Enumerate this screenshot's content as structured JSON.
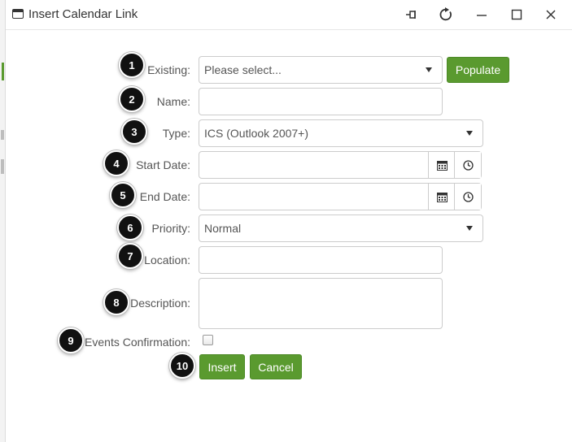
{
  "window": {
    "title": "Insert Calendar Link",
    "controls": [
      "pin-icon",
      "refresh-icon",
      "minimize-icon",
      "maximize-icon",
      "close-icon"
    ]
  },
  "form": {
    "existing": {
      "label": "Existing:",
      "value": "Please select...",
      "badge": "1"
    },
    "populate_label": "Populate",
    "name": {
      "label": "Name:",
      "value": "",
      "badge": "2"
    },
    "type": {
      "label": "Type:",
      "value": "ICS (Outlook 2007+)",
      "badge": "3"
    },
    "start_date": {
      "label": "Start Date:",
      "value": "",
      "badge": "4"
    },
    "end_date": {
      "label": "End Date:",
      "value": "",
      "badge": "5"
    },
    "priority": {
      "label": "Priority:",
      "value": "Normal",
      "badge": "6"
    },
    "location": {
      "label": "Location:",
      "value": "",
      "badge": "7"
    },
    "description": {
      "label": "Description:",
      "value": "",
      "badge": "8"
    },
    "events_confirmation": {
      "label": "Events Confirmation:",
      "checked": false,
      "badge": "9"
    },
    "insert_label": "Insert",
    "insert_badge": "10",
    "cancel_label": "Cancel"
  },
  "colors": {
    "accent_green": "#5a9a2f",
    "badge_black": "#111111",
    "border": "#cccccc"
  }
}
